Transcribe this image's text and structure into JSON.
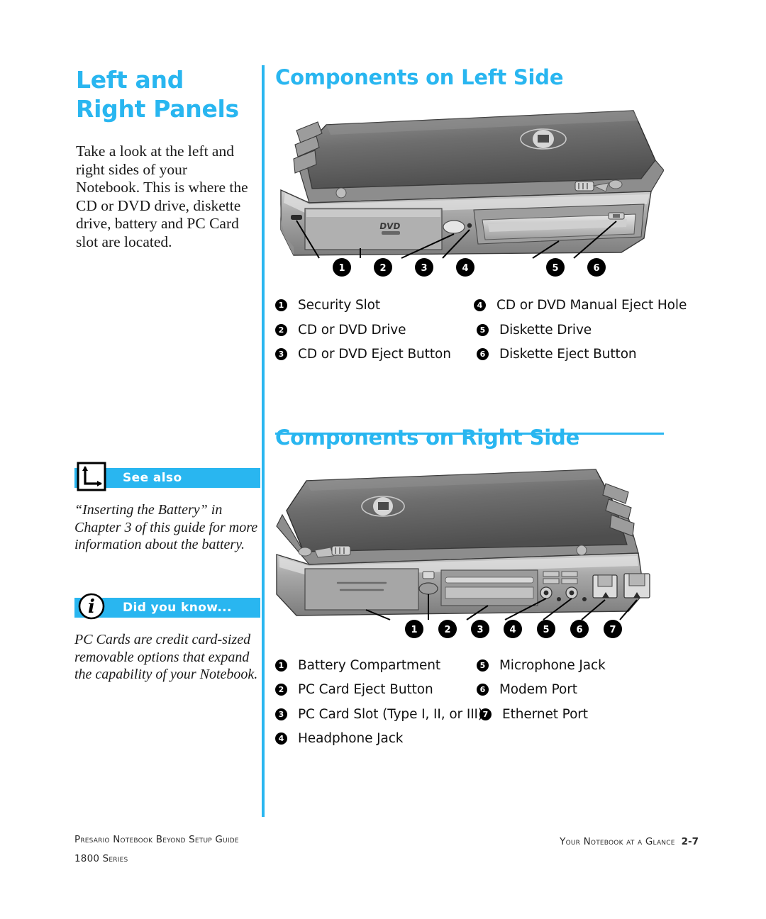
{
  "colors": {
    "accent_blue": "#29B6F0",
    "text_black": "#111111",
    "callout_white": "#FFFFFF"
  },
  "left_column": {
    "chapter_title_line1": "Left and",
    "chapter_title_line2": "Right Panels",
    "intro_paragraph": "Take a look at the left and right sides of your Notebook. This is where the CD or DVD drive, diskette drive, battery and PC Card slot are located.",
    "callouts": [
      {
        "icon": "see-also-arrow-icon",
        "label": "See also",
        "body": "“Inserting the Battery” in Chapter 3 of this guide for more information about the battery."
      },
      {
        "icon": "info-circle-icon",
        "label": "Did you know...",
        "body": "PC Cards are credit card-sized removable options that expand the capability of your Notebook."
      }
    ]
  },
  "sections": [
    {
      "heading": "Components on Left Side",
      "figure_name": "notebook-left-side-illustration",
      "figure_labels": {
        "dvd_badge": "DVD"
      },
      "callout_numbers": [
        "1",
        "2",
        "3",
        "4",
        "5",
        "6"
      ],
      "legend": [
        {
          "num": "❶",
          "label": "Security Slot"
        },
        {
          "num": "❷",
          "label": "CD or DVD Drive"
        },
        {
          "num": "❸",
          "label": "CD or DVD Eject Button"
        },
        {
          "num": "❹",
          "label": "CD or DVD Manual Eject Hole"
        },
        {
          "num": "❺",
          "label": "Diskette Drive"
        },
        {
          "num": "❻",
          "label": "Diskette Eject Button"
        }
      ]
    },
    {
      "heading": "Components on Right Side",
      "figure_name": "notebook-right-side-illustration",
      "callout_numbers": [
        "1",
        "2",
        "3",
        "4",
        "5",
        "6",
        "7"
      ],
      "legend": [
        {
          "num": "❶",
          "label": "Battery Compartment"
        },
        {
          "num": "❷",
          "label": "PC Card Eject Button"
        },
        {
          "num": "❸",
          "label": "PC Card Slot (Type I, II, or III)"
        },
        {
          "num": "❹",
          "label": "Headphone Jack"
        },
        {
          "num": "❺",
          "label": "Microphone Jack"
        },
        {
          "num": "❻",
          "label": "Modem Port"
        },
        {
          "num": "❼",
          "label": "Ethernet Port"
        }
      ]
    }
  ],
  "footer": {
    "left_line1": "Presario Notebook Beyond Setup Guide",
    "left_line2": "1800 Series",
    "right_text": "Your Notebook at a Glance",
    "page_number": "2-7"
  }
}
